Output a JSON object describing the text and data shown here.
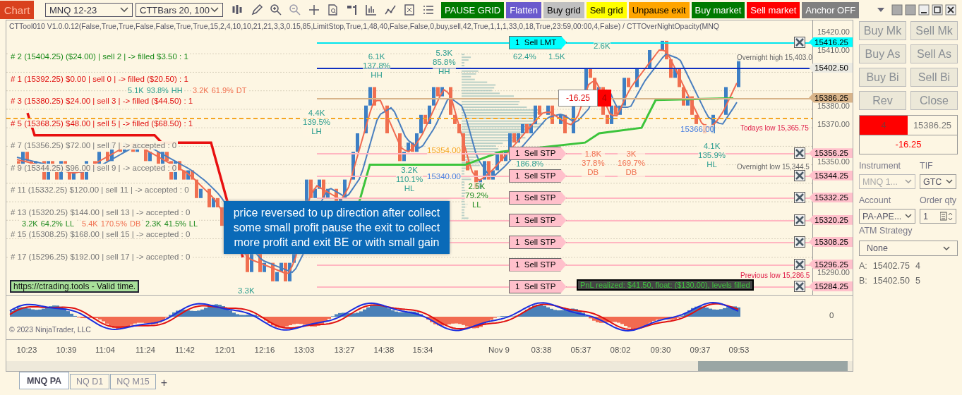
{
  "toolbar": {
    "chart_button": "Chart",
    "instrument": "MNQ 12-23",
    "bar_type": "CTTBars 20, 100",
    "buttons": [
      {
        "label": "PAUSE GRID",
        "color": "#007a00"
      },
      {
        "label": "Flatten",
        "color": "#6a5acd"
      },
      {
        "label": "Buy grid",
        "color": "#c0c0c0"
      },
      {
        "label": "Sell grid",
        "color": "#ffff00"
      },
      {
        "label": "Unpause exit",
        "color": "#ffa500"
      },
      {
        "label": "Buy market",
        "color": "#007a00"
      },
      {
        "label": "Sell market",
        "color": "#ff0000"
      },
      {
        "label": "Anchor OFF",
        "color": "#808080"
      }
    ]
  },
  "chart": {
    "indicator_line": "CTTool010 V1.0.0.12(False,True,True,False,False,True,True,15,2,4,10,10,21,21,3,3,0.15,85,LimitStop,True,1,48,40,False,False,0,buy,sell,42,True,1,1,1,33,0,18,True,23:59,00:00,4,False) / CTTOverNightOpacity(MNQ",
    "grid_levels": [
      {
        "text": "# 2 (15404.25) ($24.00) | sell 2 | -> filled $3.50 : 1",
        "kind": "profit"
      },
      {
        "text": "# 1 (15392.25) $0.00 | sell 0 | -> filled ($20.50) : 1",
        "kind": "loss"
      },
      {
        "text": "# 3 (15380.25) $24.00 | sell 3 | -> filled ($44.50) : 1",
        "kind": "loss"
      },
      {
        "text": "# 5 (15368.25) $48.00 | sell 5 | -> filled ($68.50) : 1",
        "kind": "loss"
      },
      {
        "text": "# 7 (15356.25) $72.00 | sell 7 | -> accepted : 0",
        "kind": "accepted"
      },
      {
        "text": "# 9 (15344.25) $96.00 | sell 9 | -> accepted : 0",
        "kind": "accepted"
      },
      {
        "text": "# 11 (15332.25) $120.00 | sell 11 | -> accepted : 0",
        "kind": "accepted"
      },
      {
        "text": "# 13 (15320.25) $144.00 | sell 13 | -> accepted : 0",
        "kind": "accepted"
      },
      {
        "text": "# 15 (15308.25) $168.00 | sell 15 | -> accepted : 0",
        "kind": "accepted"
      },
      {
        "text": "# 17 (15296.25) $192.00 | sell 17 | -> accepted : 0",
        "kind": "accepted"
      }
    ],
    "swings": [
      {
        "label": "HH",
        "pct": "93.8%",
        "volume": "5.1K",
        "kind": "high"
      },
      {
        "label": "DT",
        "pct": "61.9%",
        "volume": "3.2K",
        "kind": "double"
      },
      {
        "label": "LL",
        "pct": "64.2%",
        "volume": "3.2K",
        "kind": "low"
      },
      {
        "label": "DB",
        "pct": "170.5%",
        "volume": "5.4K",
        "kind": "double"
      },
      {
        "label": "LL",
        "pct": "41.5%",
        "volume": "2.3K",
        "kind": "low"
      },
      {
        "label": "LH",
        "pct": "139.5%",
        "volume": "4.4K",
        "kind": "high"
      },
      {
        "label": "HH",
        "pct": "137.8%",
        "volume": "6.1K",
        "kind": "high"
      },
      {
        "label": "HH",
        "pct": "85.8%",
        "volume": "5.3K",
        "kind": "high"
      },
      {
        "label": "HL",
        "pct": "110.1%",
        "volume": "3.2K",
        "kind": "high"
      },
      {
        "label": "LL",
        "pct": "79.2%",
        "volume": "2.5K",
        "kind": "low"
      },
      {
        "label": "DB",
        "pct": "37.8%",
        "volume": "1.8K",
        "kind": "double"
      },
      {
        "label": "DB",
        "pct": "169.7%",
        "volume": "3K",
        "kind": "double"
      },
      {
        "label": "HL",
        "pct": "135.9%",
        "volume": "4.1K",
        "kind": "high"
      }
    ],
    "price_marks": [
      {
        "text": "15354.00",
        "kind": "orange"
      },
      {
        "text": "15340.00",
        "kind": "blue"
      },
      {
        "text": "15366.00",
        "kind": "blue"
      }
    ],
    "levels": [
      {
        "text": "Overnight high 15,403.0",
        "kind": "gray"
      },
      {
        "text": "Todays low 15,365.75",
        "kind": "red"
      },
      {
        "text": "Overnight low 15,344.5",
        "kind": "gray"
      },
      {
        "text": "Previous low 15,286.5",
        "kind": "red"
      }
    ],
    "orders": [
      {
        "label": "1  Sell LMT",
        "price": "15416.25",
        "kind": "limit"
      },
      {
        "label": "1  Sell STP",
        "price": "15356.25",
        "kind": "stop"
      },
      {
        "label": "1  Sell STP",
        "price": "15344.25",
        "kind": "stop"
      },
      {
        "label": "1  Sell STP",
        "price": "15332.25",
        "kind": "stop"
      },
      {
        "label": "1  Sell STP",
        "price": "15320.25",
        "kind": "stop"
      },
      {
        "label": "1  Sell STP",
        "price": "15308.25",
        "kind": "stop"
      },
      {
        "label": "1  Sell STP",
        "price": "15296.25",
        "kind": "stop"
      },
      {
        "label": "1  Sell STP",
        "price": "15284.25",
        "kind": "stop"
      }
    ],
    "price_tags": [
      {
        "price": "15402.50",
        "kind": "last"
      },
      {
        "price": "15386.25",
        "kind": "average"
      }
    ],
    "position_flag": {
      "pnl": "-16.25",
      "quantity": "4"
    },
    "axis_ticks": [
      "15420.00",
      "15410.00",
      "15380.00",
      "15370.00",
      "15350.00",
      "15290.00"
    ],
    "callout": "price reversed to up direction after collect some small profit pause the exit to collect more profit and exit BE or with small gain",
    "url_note": "https://ctrading.tools - Valid time.",
    "pnl_note": "PnL realized: $41.50, float: ($130.00), levels filled",
    "small_labels": [
      "186.8%",
      "62.4%",
      "1.5K",
      "2.6K",
      "3.3K"
    ],
    "oscillator_tick": "0",
    "copyright": "© 2023 NinjaTrader, LLC",
    "time_labels": [
      "10:23",
      "10:39",
      "11:04",
      "11:24",
      "11:42",
      "12:01",
      "12:16",
      "13:03",
      "13:27",
      "14:38",
      "15:34",
      "Nov 9",
      "03:38",
      "05:37",
      "08:02",
      "09:30",
      "09:37",
      "09:53"
    ]
  },
  "tabs": [
    {
      "label": "MNQ PA",
      "selected": true
    },
    {
      "label": "NQ D1",
      "selected": false
    },
    {
      "label": "NQ M15",
      "selected": false
    }
  ],
  "add_tab": "+",
  "side_panel": {
    "buttons": [
      "Buy Mk",
      "Sell Mk",
      "Buy As",
      "Sell As",
      "Buy Bi",
      "Sell Bi",
      "Rev",
      "Close"
    ],
    "position": {
      "quantity": "4",
      "average": "15386.25",
      "pnl": "-16.25",
      "short": true
    },
    "instrument_label": "Instrument",
    "instrument": "MNQ 1...",
    "tif_label": "TIF",
    "tif": "GTC",
    "account_label": "Account",
    "account": "PA-APE...",
    "qty_label": "Order qty",
    "qty": "1",
    "atm_label": "ATM Strategy",
    "atm": "None",
    "quotes": [
      {
        "side": "A:",
        "price": "15402.75",
        "size": "4"
      },
      {
        "side": "B:",
        "price": "15402.50",
        "size": "5"
      }
    ]
  }
}
